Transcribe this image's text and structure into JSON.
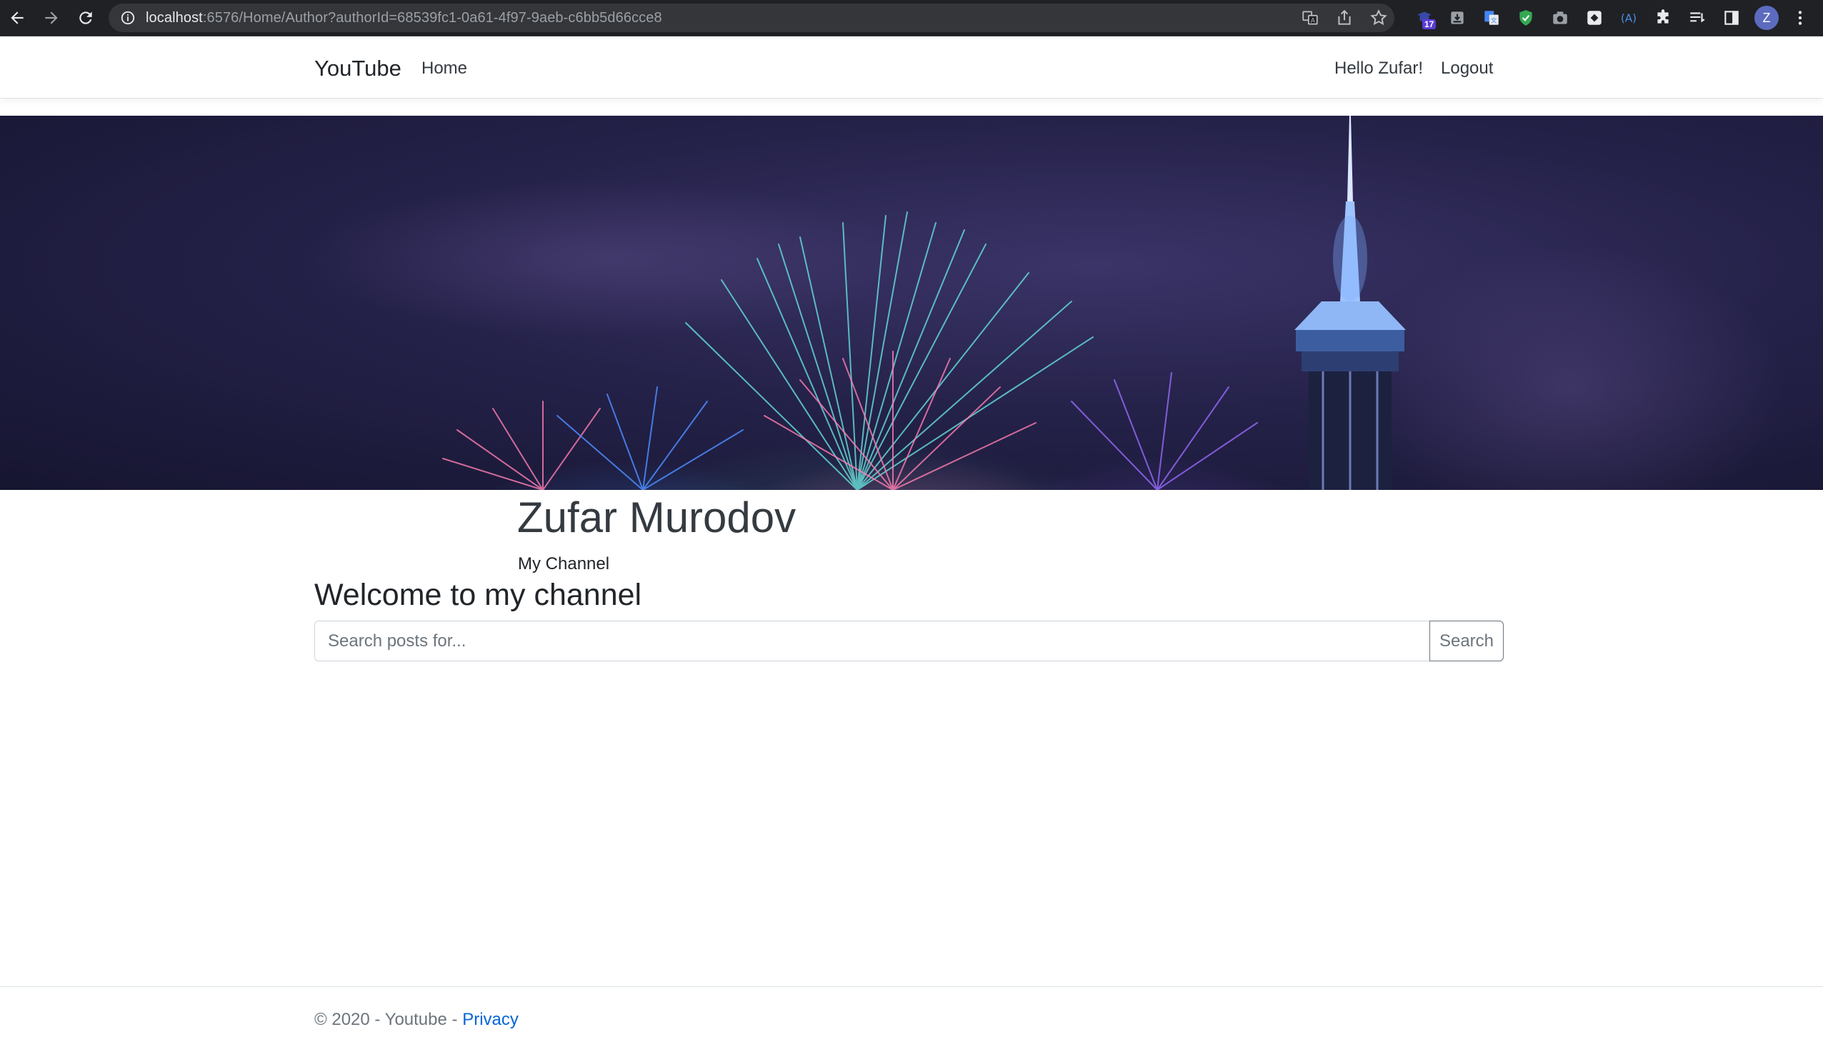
{
  "browser": {
    "url_host": "localhost",
    "url_rest": ":6576/Home/Author?authorId=68539fc1-0a61-4f97-9aeb-c6bb5d66cce8",
    "extension_badge": "17",
    "profile_initial": "Z",
    "icons": [
      "back-icon",
      "forward-icon",
      "reload-icon",
      "info-icon",
      "translate-icon",
      "share-icon",
      "bookmark-star-icon",
      "extension-icon",
      "download-icon",
      "google-translate-icon",
      "shield-icon",
      "camera-icon",
      "ext-square-icon",
      "ext-a-icon",
      "puzzle-icon",
      "reading-list-icon",
      "side-panel-icon",
      "menu-kebab-icon"
    ]
  },
  "nav": {
    "brand": "YouTube",
    "home": "Home",
    "greeting": "Hello Zufar!",
    "logout": "Logout"
  },
  "channel": {
    "name": "Zufar Murodov",
    "subtitle": "My Channel",
    "welcome": "Welcome to my channel"
  },
  "search": {
    "placeholder": "Search posts for...",
    "button": "Search"
  },
  "footer": {
    "text": "© 2020 - Youtube - ",
    "privacy": "Privacy"
  },
  "colors": {
    "link": "#0366d6",
    "banner_dark": "#25224a"
  }
}
